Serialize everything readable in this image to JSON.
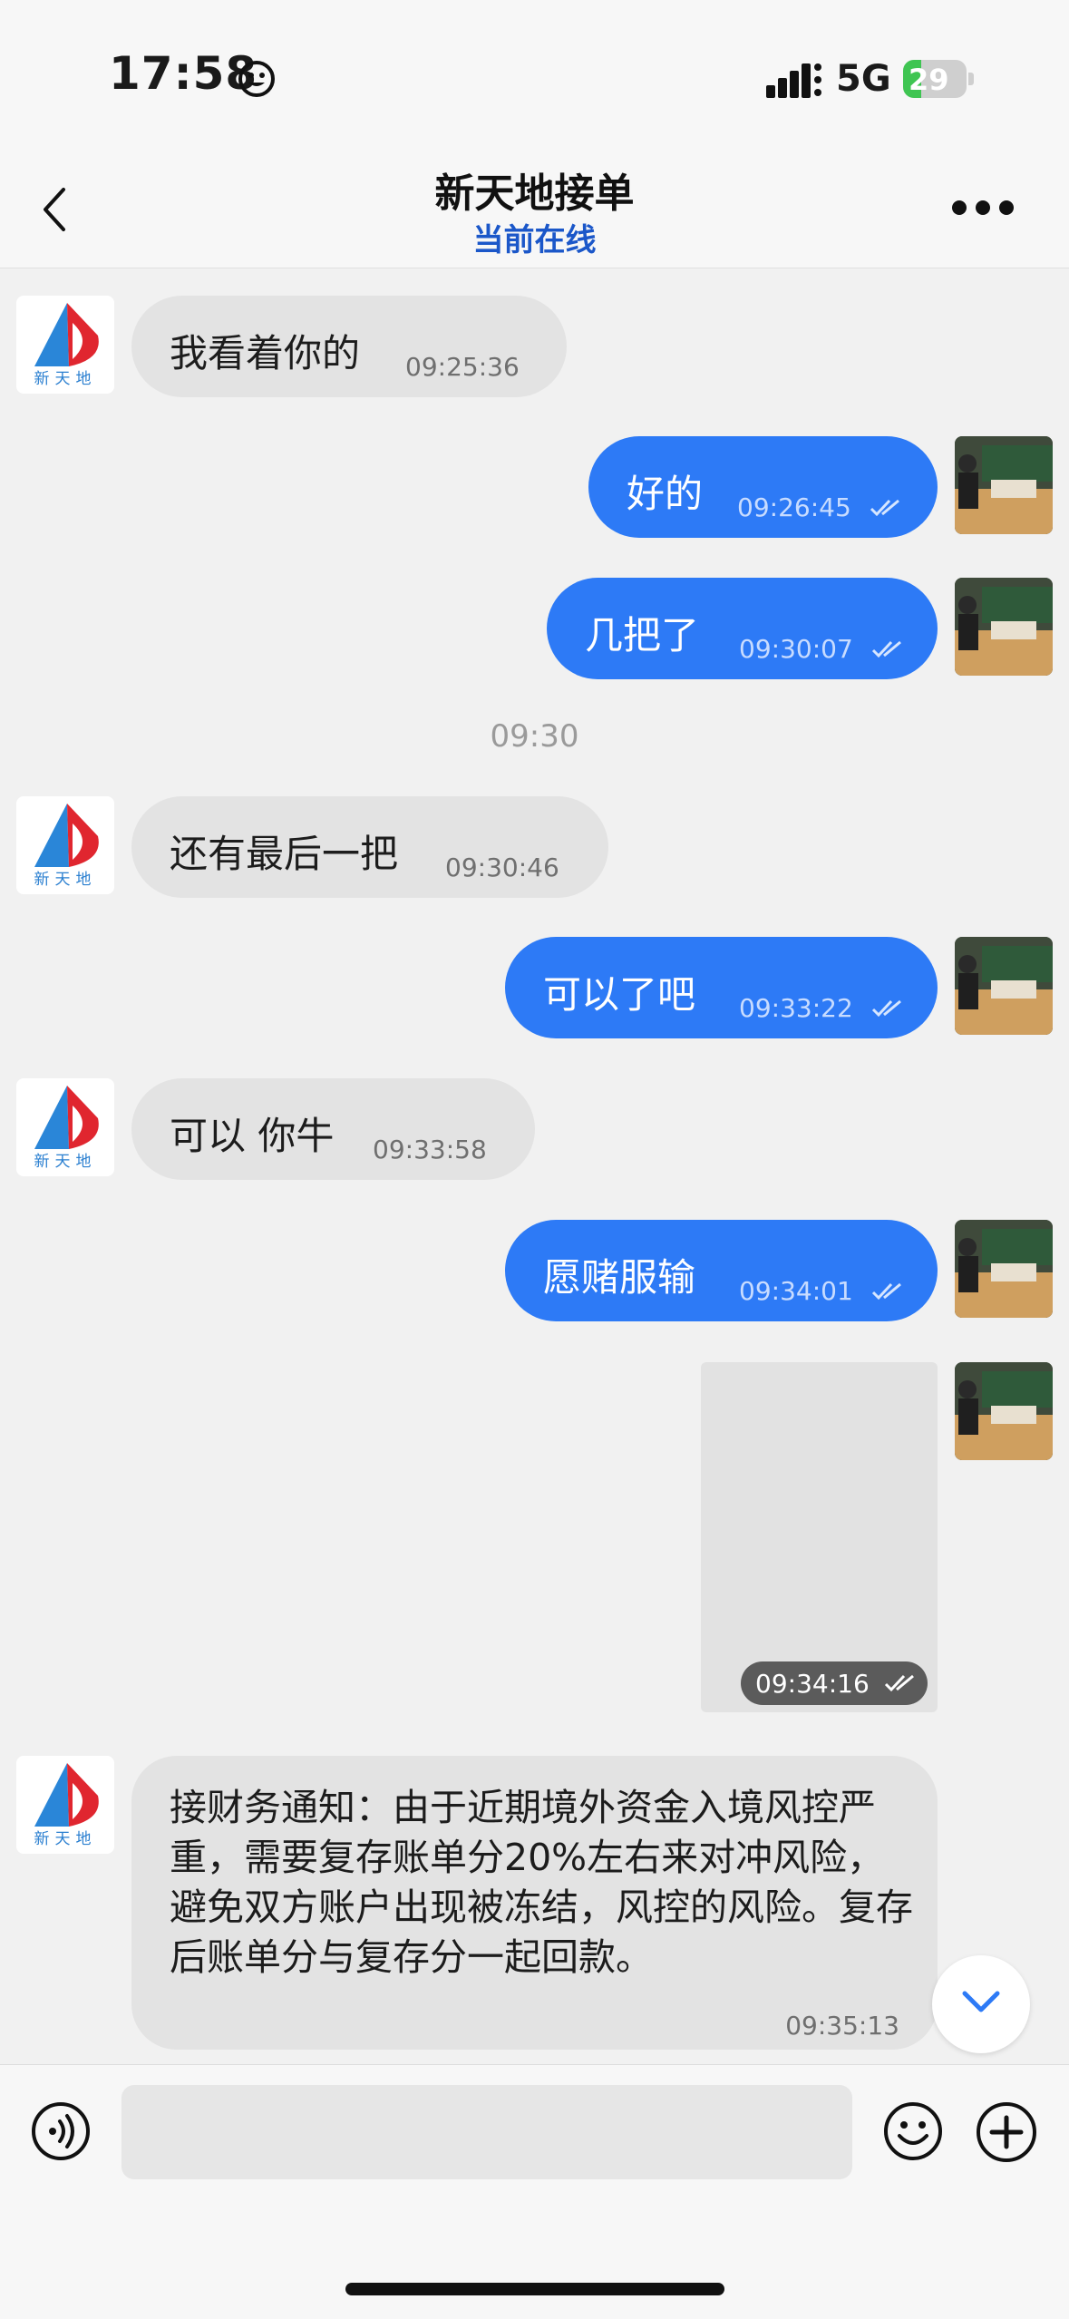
{
  "status_bar": {
    "time": "17:58",
    "network": "5G",
    "battery_level": "29",
    "battery_fraction": 0.29
  },
  "header": {
    "title": "新天地接单",
    "status": "当前在线"
  },
  "contact": {
    "logo_text": "新天地"
  },
  "messages": [
    {
      "side": "in",
      "text": "我看着你的",
      "time": "09:25:36"
    },
    {
      "side": "out",
      "text": "好的",
      "time": "09:26:45"
    },
    {
      "side": "out",
      "text": "几把了",
      "time": "09:30:07"
    },
    {
      "type": "separator",
      "text": "09:30"
    },
    {
      "side": "in",
      "text": "还有最后一把",
      "time": "09:30:46"
    },
    {
      "side": "out",
      "text": "可以了吧",
      "time": "09:33:22"
    },
    {
      "side": "in",
      "text": "可以 你牛",
      "time": "09:33:58"
    },
    {
      "side": "out",
      "text": "愿赌服输",
      "time": "09:34:01"
    },
    {
      "side": "out",
      "type": "image",
      "time": "09:34:16"
    },
    {
      "side": "in",
      "text": "接财务通知：由于近期境外资金入境风控严重，需要复存账单分20%左右来对冲风险，避免双方账户出现被冻结，风控的风险。复存后账单分与复存分一起回款。",
      "time": "09:35:13"
    }
  ],
  "input": {
    "placeholder": ""
  },
  "colors": {
    "outgoing_bubble": "#2d7af6",
    "incoming_bubble": "#e3e3e3",
    "status_link": "#1b57c9",
    "battery": "#3fc552"
  }
}
